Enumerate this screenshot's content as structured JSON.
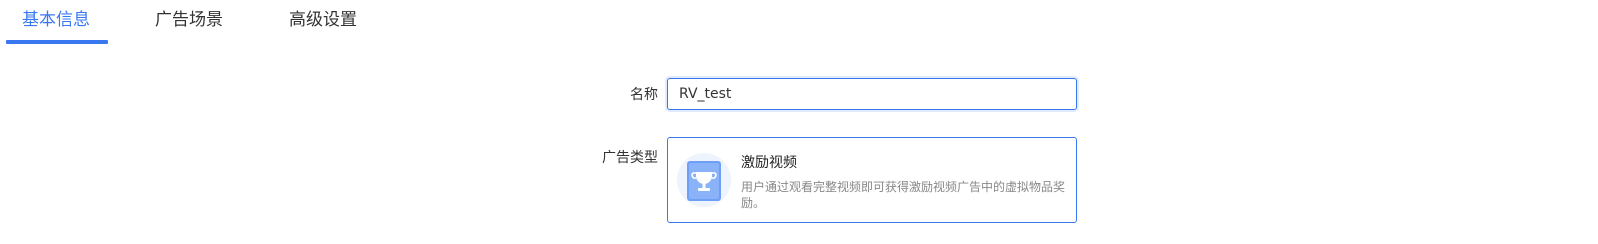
{
  "tabs": [
    {
      "label": "基本信息",
      "active": true
    },
    {
      "label": "广告场景",
      "active": false
    },
    {
      "label": "高级设置",
      "active": false
    }
  ],
  "form": {
    "name_label": "名称",
    "name_value": "RV_test",
    "ad_type_label": "广告类型",
    "ad_type_option": {
      "title": "激励视频",
      "description": "用户通过观看完整视频即可获得激励视频广告中的虚拟物品奖励。",
      "icon": "trophy-video-icon",
      "selected": true
    }
  },
  "colors": {
    "accent": "#3a78f2",
    "text": "#333333",
    "muted": "#888888"
  }
}
